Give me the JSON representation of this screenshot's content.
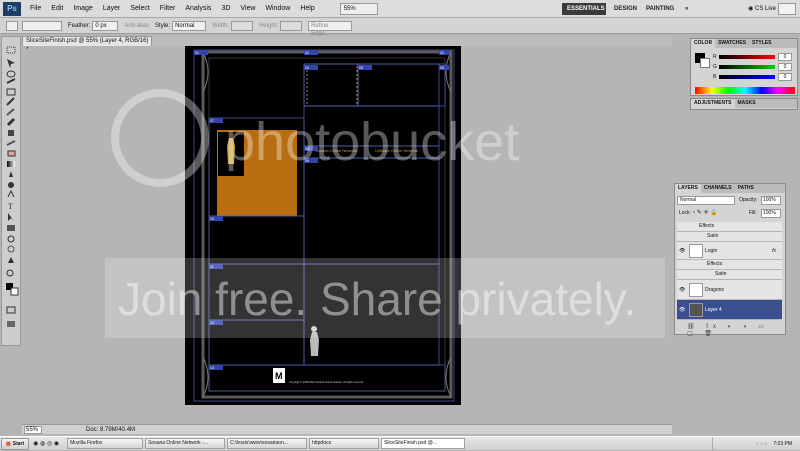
{
  "menubar": {
    "logo": "Ps",
    "items": [
      "File",
      "Edit",
      "Image",
      "Layer",
      "Select",
      "Filter",
      "Analysis",
      "3D",
      "View",
      "Window",
      "Help"
    ],
    "zoom": "55%",
    "workspaces": [
      "ESSENTIALS",
      "DESIGN",
      "PAINTING"
    ],
    "more": "»",
    "cs_live": "CS Live"
  },
  "options": {
    "feather_label": "Feather:",
    "feather_value": "0 px",
    "antialias": "Anti-alias",
    "style_label": "Style:",
    "style_value": "Normal",
    "width_label": "Width:",
    "height_label": "Height:",
    "refine": "Refine Edge..."
  },
  "document": {
    "tab_title": "SliceSiteFinish.psd @ 55% (Layer 4, RGB/16) *",
    "zoom": "55%",
    "doc_info": "Doc: 8.79M/40.4M",
    "slices": [
      "01",
      "02",
      "03",
      "04",
      "05",
      "06",
      "07",
      "08",
      "09",
      "10",
      "11",
      "12",
      "13",
      "14",
      "15",
      "16",
      "17",
      "18"
    ],
    "menu_text_a": "Sosaria Online Network",
    "menu_text_b": "Ultimate Online Network",
    "esrb": "M",
    "footer_small": "Copyright © 2008-2010 Sosaria Online Network. All rights reserved."
  },
  "color_panel": {
    "tabs": [
      "COLOR",
      "SWATCHES",
      "STYLES"
    ],
    "channels": [
      {
        "label": "R",
        "value": "0",
        "color": "#e02020"
      },
      {
        "label": "G",
        "value": "0",
        "color": "#20a020"
      },
      {
        "label": "B",
        "value": "0",
        "color": "#2040e0"
      }
    ]
  },
  "adjustments_panel": {
    "tabs": [
      "ADJUSTMENTS",
      "MASKS"
    ]
  },
  "layers_panel": {
    "tabs": [
      "LAYERS",
      "CHANNELS",
      "PATHS"
    ],
    "blend_mode": "Normal",
    "opacity_label": "Opacity:",
    "opacity_value": "100%",
    "lock_label": "Lock:",
    "fill_label": "Fill:",
    "fill_value": "100%",
    "layers": [
      {
        "name": "Effects",
        "kind": "effects"
      },
      {
        "name": "Satin",
        "kind": "effect"
      },
      {
        "name": "Login",
        "kind": "layer",
        "fx": "fx"
      },
      {
        "name": "Effects",
        "kind": "effects"
      },
      {
        "name": "Satin",
        "kind": "effect"
      },
      {
        "name": "Dragons",
        "kind": "layer",
        "fx": ""
      },
      {
        "name": "Layer 4",
        "kind": "layer",
        "fx": "",
        "selected": true
      }
    ]
  },
  "watermark": {
    "logo": "photobucket",
    "tagline": "Join free. Share privately."
  },
  "taskbar": {
    "start": "Start",
    "buttons": [
      "Mozilla Firefox",
      "Sosaria Online Network -...",
      "C:\\hosts\\www\\sosariaon...",
      "httpdocs",
      "SliceSiteFinish.psd @..."
    ],
    "active": 4,
    "clock": "7:03 PM"
  }
}
